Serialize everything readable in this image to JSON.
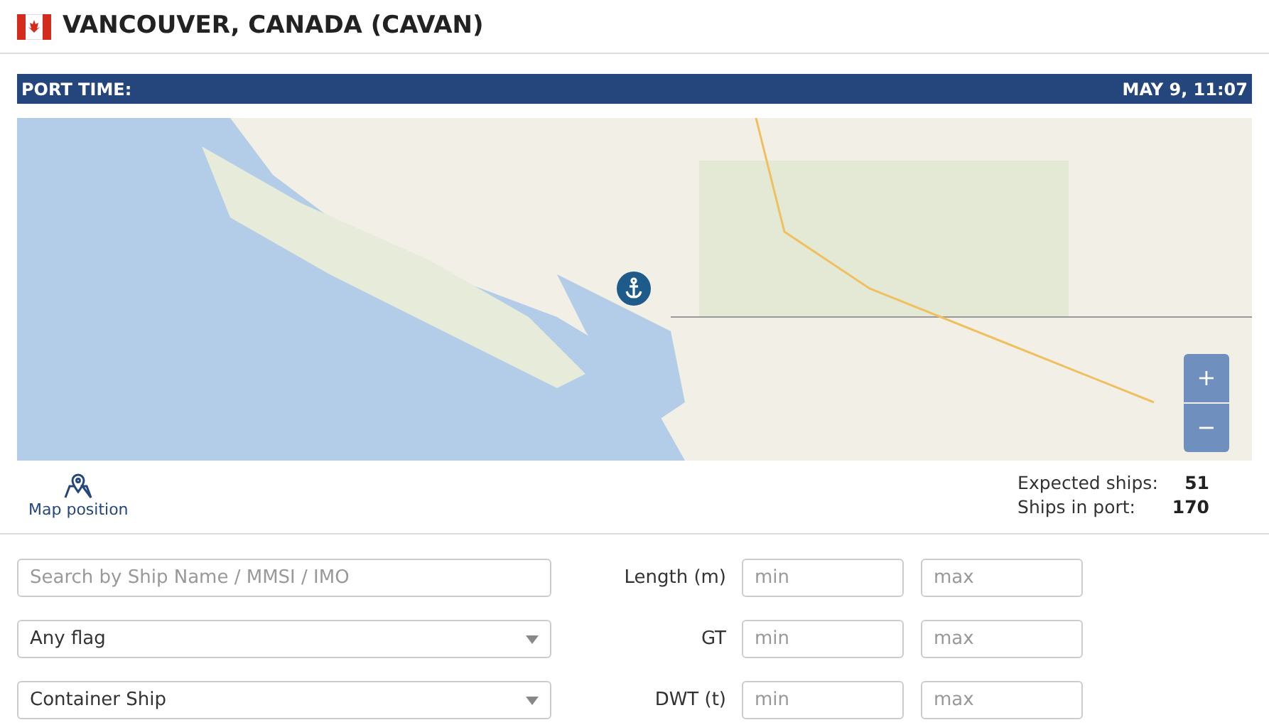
{
  "header": {
    "title": "VANCOUVER, CANADA (CAVAN)"
  },
  "port_time": {
    "label": "PORT TIME:",
    "value": "MAY 9, 11:07"
  },
  "map": {
    "zoom_in": "+",
    "zoom_out": "−"
  },
  "map_position": {
    "label": "Map position"
  },
  "stats": [
    {
      "label": "Expected ships:",
      "value": "51"
    },
    {
      "label": "Ships in port:",
      "value": "170"
    }
  ],
  "filters": {
    "search": {
      "placeholder": "Search by Ship Name / MMSI / IMO"
    },
    "flag": {
      "value": "Any flag"
    },
    "type": {
      "value": "Container Ship"
    },
    "ranges": [
      {
        "label": "Length (m)",
        "min_placeholder": "min",
        "max_placeholder": "max"
      },
      {
        "label": "GT",
        "min_placeholder": "min",
        "max_placeholder": "max"
      },
      {
        "label": "DWT (t)",
        "min_placeholder": "min",
        "max_placeholder": "max"
      }
    ]
  }
}
